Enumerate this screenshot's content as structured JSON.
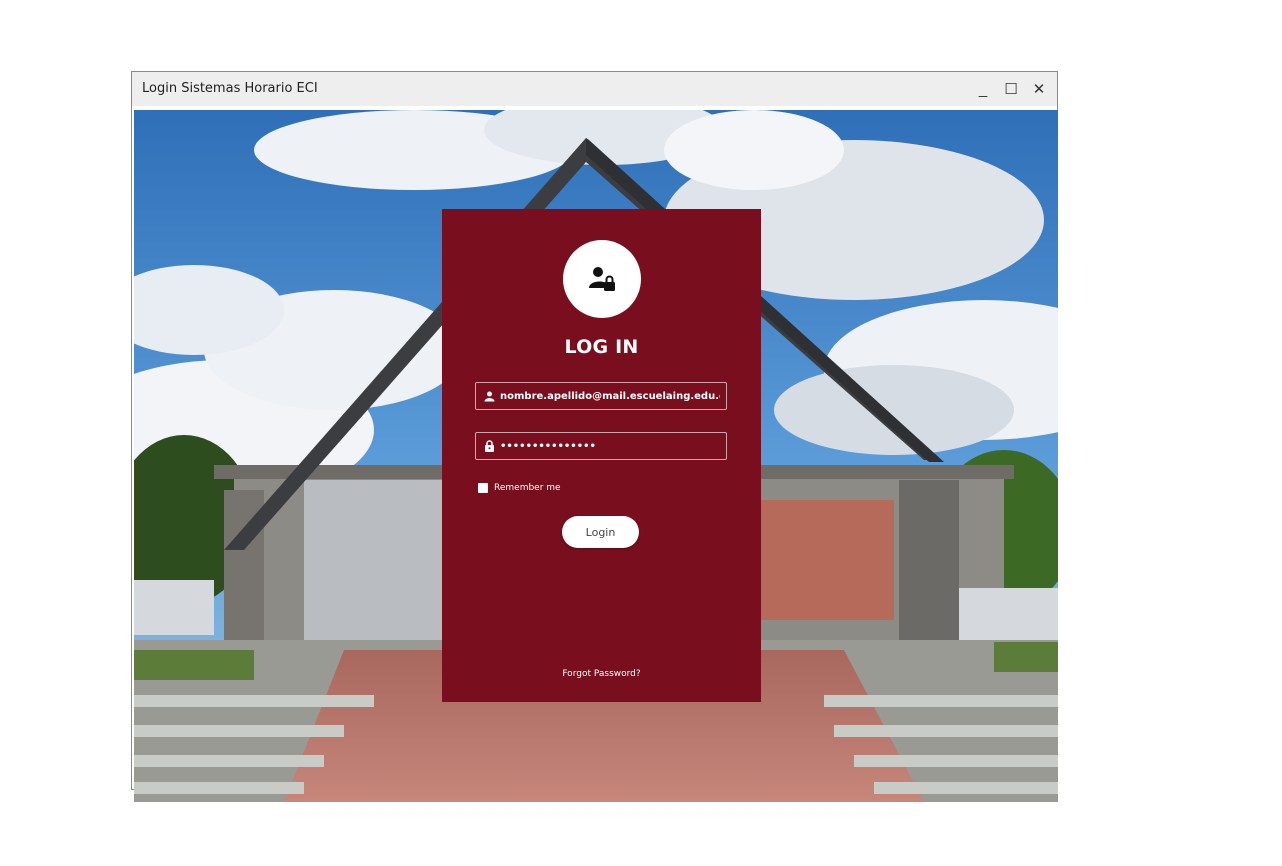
{
  "window": {
    "title": "Login Sistemas Horario ECI",
    "controls": {
      "minimize": "_",
      "maximize": "☐",
      "close": "✕"
    }
  },
  "login": {
    "heading": "LOG IN",
    "username": {
      "value": "nombre.apellido@mail.escuelaing.edu.co",
      "icon": "user-icon"
    },
    "password": {
      "value": "•••••••••••••••",
      "icon": "lock-icon"
    },
    "remember_label": "Remember me",
    "remember_checked": false,
    "login_button": "Login",
    "forgot_link": "Forgot Password?",
    "avatar_icon": "user-lock-icon"
  },
  "colors": {
    "card": "#780e1e",
    "sky": "#3a7fc4",
    "titlebar": "#eeeeee"
  }
}
